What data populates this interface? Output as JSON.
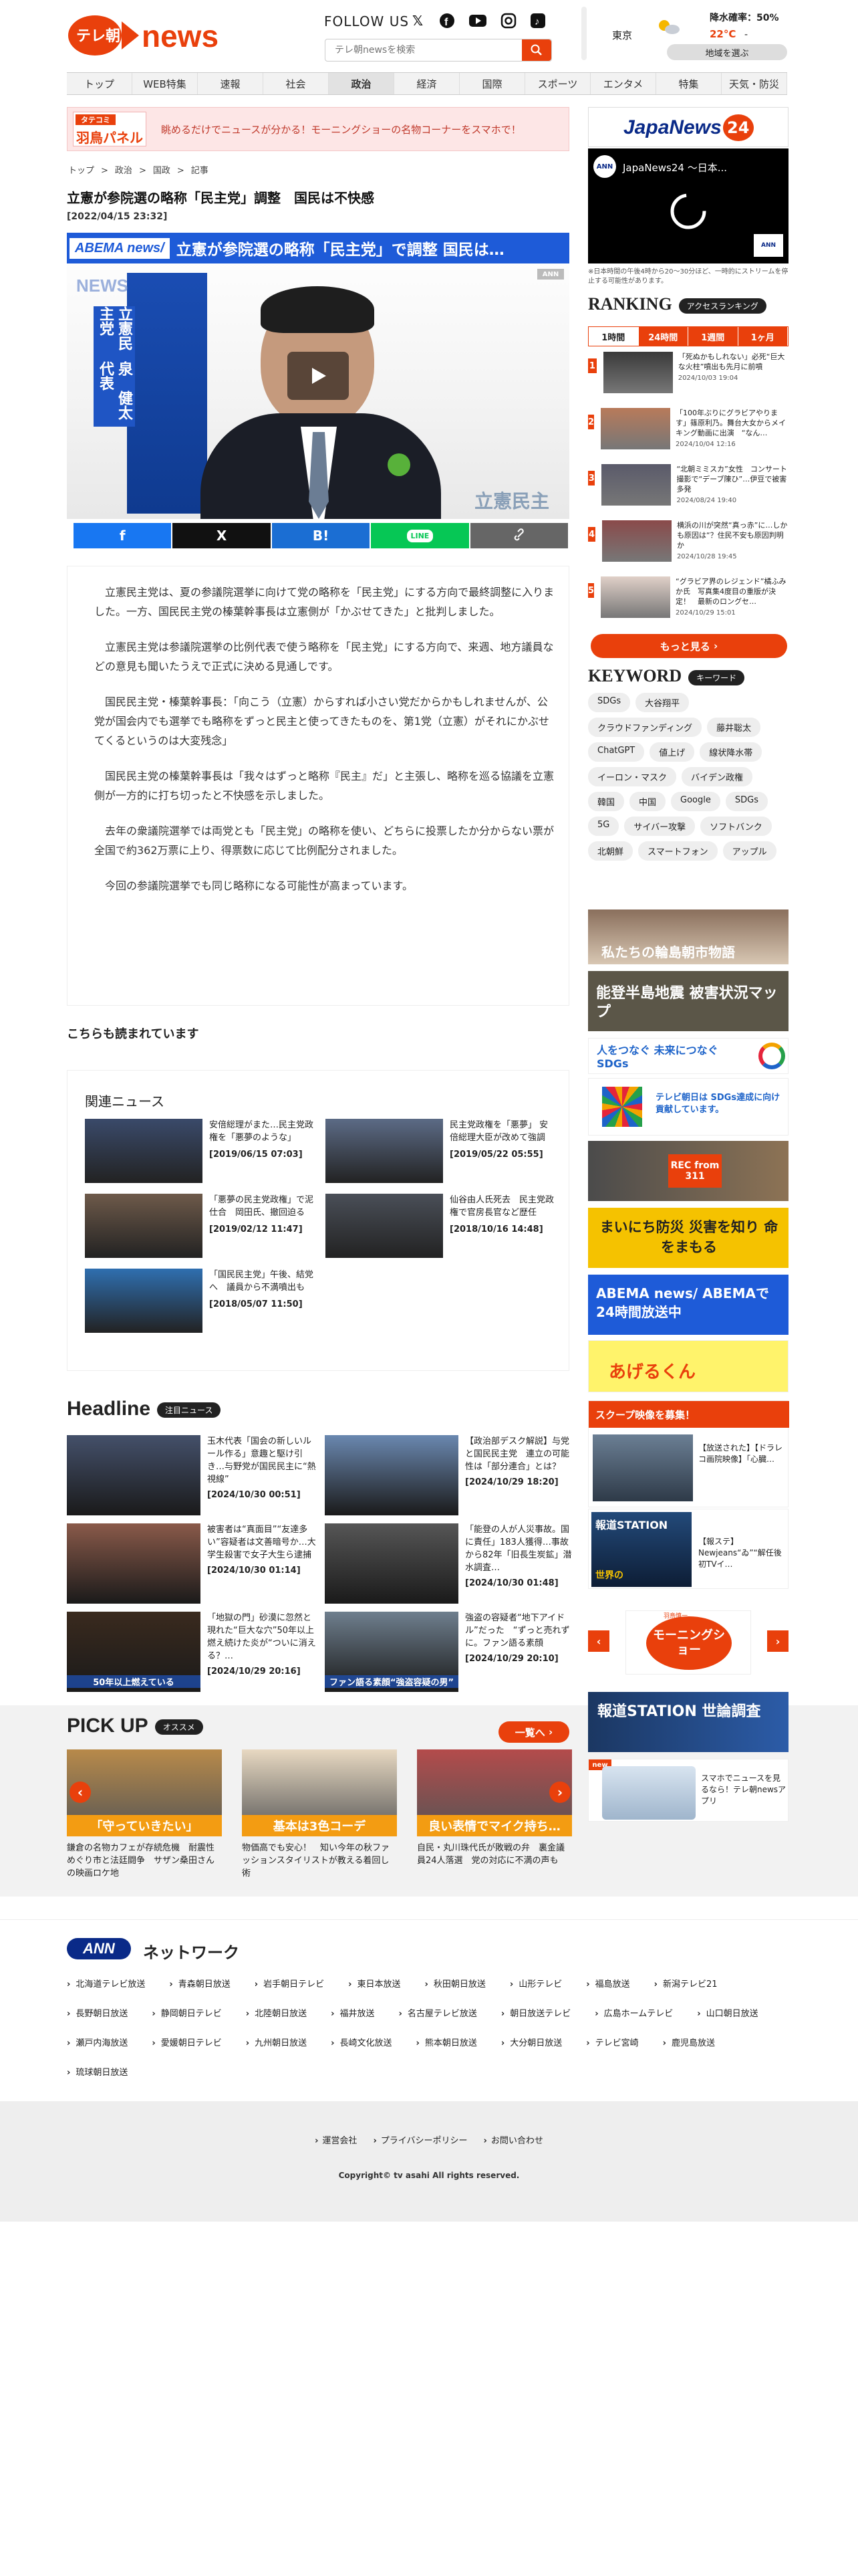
{
  "header": {
    "follow_label": "FOLLOW US",
    "search_placeholder": "テレ朝newsを検索",
    "weather": {
      "city": "東京",
      "rain_label": "降水確率：50%",
      "temp": "22°C",
      "temp_low": "-",
      "region_button": "地域を選ぶ"
    },
    "brand_color": "#e9400c"
  },
  "nav": [
    "トップ",
    "WEB特集",
    "速報",
    "社会",
    "政治",
    "経済",
    "国際",
    "スポーツ",
    "エンタメ",
    "特集",
    "天気・防災"
  ],
  "nav_active": "政治",
  "banner": {
    "logo_top": "タテコミ",
    "logo_bottom": "羽鳥パネル",
    "text": "眺めるだけでニュースが分かる！モーニングショーの名物コーナーをスマホで！"
  },
  "breadcrumb": [
    "トップ",
    ">",
    "政治",
    ">",
    "国政",
    ">",
    "記事"
  ],
  "article": {
    "title": "立憲が参院選の略称「民主党」調整　国民は不快感",
    "date": "[2022/04/15 23:32]",
    "video_caption": "立憲が参院選の略称「民主党」で調整 国民は…",
    "video_badge": "ABEMA news/",
    "video_watermark": "NEWS",
    "video_side_label": "立憲民主党",
    "video_side_name": "泉　健太代表",
    "video_corner": "立憲民主",
    "paragraphs": [
      "立憲民主党は、夏の参議院選挙に向けて党の略称を「民主党」にする方向で最終調整に入りました。一方、国民民主党の榛葉幹事長は立憲側が「かぶせてきた」と批判しました。",
      "立憲民主党は参議院選挙の比例代表で使う略称を「民主党」にする方向で、来週、地方議員などの意見も聞いたうえで正式に決める見通しです。",
      "国民民主党・榛葉幹事長：「向こう（立憲）からすれば小さい党だからかもしれませんが、公党が国会内でも選挙でも略称をずっと民主と使ってきたものを、第1党（立憲）がそれにかぶせてくるというのは大変残念」",
      "国民民主党の榛葉幹事長は「我々はずっと略称『民主』だ」と主張し、略称を巡る協議を立憲側が一方的に打ち切ったと不快感を示しました。",
      "去年の衆議院選挙では両党とも「民主党」の略称を使い、どちらに投票したか分からない票が全国で約362万票に上り、得票数に応じて比例配分されました。",
      "今回の参議院選挙でも同じ略称になる可能性が高まっています。"
    ]
  },
  "share": [
    {
      "icon": "f",
      "color": "#1877f2"
    },
    {
      "icon": "X",
      "color": "#111111"
    },
    {
      "icon": "B!",
      "color": "#1b6ed3"
    },
    {
      "icon": "LINE",
      "color": "#06c755"
    },
    {
      "icon": "link",
      "color": "#666666"
    }
  ],
  "readmore_label": "こちらも読まれています",
  "related": {
    "title": "関連ニュース",
    "items": [
      {
        "text": "安倍総理がまた…民主党政権を「悪夢のような」",
        "date": "[2019/06/15 07:03]"
      },
      {
        "text": "民主党政権を「悪夢」 安倍総理大臣が改めて強調",
        "date": "[2019/05/22 05:55]"
      },
      {
        "text": "「悪夢の民主党政権」で泥仕合　岡田氏、撤回迫る",
        "date": "[2019/02/12 11:47]"
      },
      {
        "text": "仙谷由人氏死去　民主党政権で官房長官など歴任",
        "date": "[2018/10/16 14:48]"
      },
      {
        "text": "「国民民主党」午後、結党へ　議員から不満噴出も",
        "date": "[2018/05/07 11:50]"
      }
    ]
  },
  "headline": {
    "title": "Headline",
    "tag": "注目ニュース",
    "items": [
      {
        "text": "玉木代表「国会の新しいルール作る」意趣と駆け引き…与野党が国民民主に“熱視線”",
        "date": "[2024/10/30 00:51]"
      },
      {
        "text": "【政治部デスク解説】与党と国民民主党　連立の可能性は「部分連合」とは？",
        "date": "[2024/10/29 18:20]"
      },
      {
        "text": "被害者は“真面目”“友達多い”容疑者は文善暗号か…大学生殺害で女子大生ら逮捕",
        "date": "[2024/10/30 01:14]"
      },
      {
        "text": "「能登の人が人災事故。国に責任」183人獲得…事故から82年「旧長生炭鉱」潜水調査…",
        "date": "[2024/10/30 01:48]"
      },
      {
        "text": "「地獄の門」砂漠に忽然と現れた“巨大な穴”50年以上燃え続けた炎が“ついに消える？…",
        "date": "[2024/10/29 20:16]"
      },
      {
        "text": "強盗の容疑者“地下アイドル”だった　“ずっと売れずに。ファン語る素顔",
        "date": "[2024/10/29 20:10]"
      }
    ],
    "thumb_captions": [
      "",
      "",
      "",
      "",
      "50年以上燃えている",
      "ファン語る素顔“強盗容疑の男”"
    ]
  },
  "pickup": {
    "title": "PICK UP",
    "tag": "オススメ",
    "more_label": "一覧へ",
    "items": [
      {
        "caption": "「守っていきたい」",
        "text": "鎌倉の名物カフェが存続危機　耐震性めぐり市と法廷闘争　サザン桑田さんの映画ロケ地"
      },
      {
        "caption": "基本は3色コーデ",
        "text": "物価高でも安心！　知い今年の秋ファッションスタイリストが教える着回し術"
      },
      {
        "caption": "良い表情でマイク持ち…",
        "text": "自民・丸川珠代氏が敗戦の弁　裏金議員24人落選　党の対応に不満の声も"
      }
    ]
  },
  "sidebar": {
    "jn24_logo": "JapaNews",
    "jn24_num": "24",
    "jn24_video_title": "JapaNews24 ～日本...",
    "jn24_note": "※日本時間の午後4時から20～30分ほど、一時的にストリームを停止する可能性があります。",
    "ranking_title": "RANKING",
    "ranking_tag": "アクセスランキング",
    "ranking_tabs": [
      "1時間",
      "24時間",
      "1週間",
      "1ヶ月"
    ],
    "ranking_active": "1時間",
    "ranking": [
      {
        "n": "1",
        "text": "「死ぬかもしれない」必死“巨大な火柱”噴出も先月に前噴",
        "date": "2024/10/03 19:04"
      },
      {
        "n": "2",
        "text": "「100年ぶりにグラビアやります」篠原利乃。舞台大女からメイキング動画に出演　“なん…",
        "date": "2024/10/04 12:16"
      },
      {
        "n": "3",
        "text": "“北朝ミミスカ”女性　コンサート撮影で“デーブ陳ひ”…伊豆で被害多発",
        "date": "2024/08/24 19:40"
      },
      {
        "n": "4",
        "text": "横浜の川が突然“真っ赤”に…しかも原因は“？住民不安も原因判明か",
        "date": "2024/10/28 19:45"
      },
      {
        "n": "5",
        "text": "“グラビア界のレジェンド”橘ふみか氏　写真集4度目の重版が決定！　最新のロングセ…",
        "date": "2024/10/29 15:01"
      }
    ],
    "more_label": "もっと見る",
    "keyword_title": "KEYWORD",
    "keyword_tag": "キーワード",
    "keywords": [
      "SDGs",
      "大谷翔平",
      "クラウドファンディング",
      "藤井聡太",
      "ChatGPT",
      "値上げ",
      "線状降水帯",
      "イーロン・マスク",
      "バイデン政権",
      "韓国",
      "中国",
      "Google",
      "SDGs",
      "5G",
      "サイバー攻撃",
      "ソフトバンク",
      "北朝鮮",
      "スマートフォン",
      "アップル"
    ],
    "banners": [
      "私たちの輪島朝市物語",
      "能登半島地震 被害状況マップ",
      "人をつなぐ 未来につなぐ SDGs",
      "テレビ朝日は SDGs達成に向け 貢献しています。",
      "REC from 311",
      "まいにち防災 災害を知り 命をまもる",
      "ABEMA news/ ABEMAで24時間放送中",
      "あげるくん",
      "スクープ映像を募集！",
      "【放送された】【ドラレコ画院映像】「心臓…",
      "報道STATION",
      "【報ステ】Newjeans“ゐ”“解任後初TVイ…",
      "モーニングショー",
      "報道STATION 世論調査",
      "スマホでニュースを見るなら！テレ朝newsアプリ"
    ],
    "banner_extra": [
      "世界の",
      "羽鳥慎一",
      "ANN"
    ]
  },
  "footer": {
    "ann_logo": "ANN",
    "title": "ネットワーク",
    "stations": [
      "北海道テレビ放送",
      "青森朝日放送",
      "岩手朝日テレビ",
      "東日本放送",
      "秋田朝日放送",
      "山形テレビ",
      "福島放送",
      "新潟テレビ21",
      "長野朝日放送",
      "静岡朝日テレビ",
      "北陸朝日放送",
      "福井放送",
      "名古屋テレビ放送",
      "朝日放送テレビ",
      "広島ホームテレビ",
      "山口朝日放送",
      "瀬戸内海放送",
      "愛媛朝日テレビ",
      "九州朝日放送",
      "長崎文化放送",
      "熊本朝日放送",
      "大分朝日放送",
      "テレビ宮崎",
      "鹿児島放送",
      "琉球朝日放送"
    ],
    "links": [
      "運営会社",
      "プライバシーポリシー",
      "お問い合わせ"
    ],
    "copyright": "Copyright© tv asahi All rights reserved."
  },
  "logo": {
    "brand": "テレ朝",
    "word": "news"
  }
}
